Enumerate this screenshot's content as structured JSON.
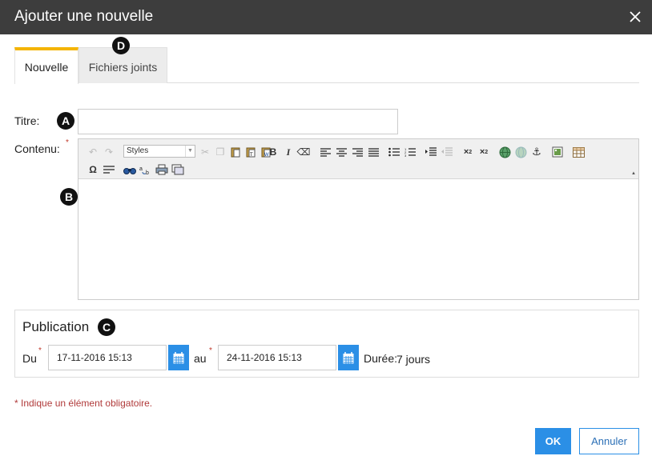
{
  "dialog": {
    "title": "Ajouter une nouvelle",
    "close_icon": "close-icon"
  },
  "tabs": [
    {
      "label": "Nouvelle",
      "active": true
    },
    {
      "label": "Fichiers joints",
      "active": false
    }
  ],
  "markers": {
    "a": "A",
    "b": "B",
    "c": "C",
    "d": "D"
  },
  "form": {
    "titre_label": "Titre:",
    "titre_value": "",
    "contenu_label": "Contenu:",
    "required_mark": "*"
  },
  "editor": {
    "styles_label": "Styles",
    "icons": [
      "undo-icon",
      "redo-icon",
      "cut-icon",
      "copy-icon",
      "paste-icon",
      "paste-text-icon",
      "paste-word-icon",
      "bold-icon",
      "italic-icon",
      "remove-format-icon",
      "align-left-icon",
      "align-center-icon",
      "align-right-icon",
      "justify-icon",
      "bullet-list-icon",
      "numbered-list-icon",
      "indent-icon",
      "outdent-icon",
      "subscript-icon",
      "superscript-icon",
      "link-icon",
      "unlink-icon",
      "anchor-icon",
      "image-icon",
      "table-icon",
      "special-char-icon",
      "horizontal-rule-icon",
      "find-icon",
      "replace-icon",
      "print-icon",
      "preview-icon"
    ]
  },
  "publication": {
    "title": "Publication",
    "du_label": "Du",
    "du_value": "17-11-2016 15:13",
    "au_label": "au",
    "au_value": "24-11-2016 15:13",
    "duree_label": "Durée:",
    "duree_value": "7 jours"
  },
  "footer": {
    "required_note": "* Indique un élément obligatoire.",
    "ok_label": "OK",
    "cancel_label": "Annuler"
  },
  "colors": {
    "titlebar": "#3d3d3d",
    "tab_accent": "#f4b400",
    "primary": "#2b8fe6",
    "required": "#b03a3a"
  }
}
